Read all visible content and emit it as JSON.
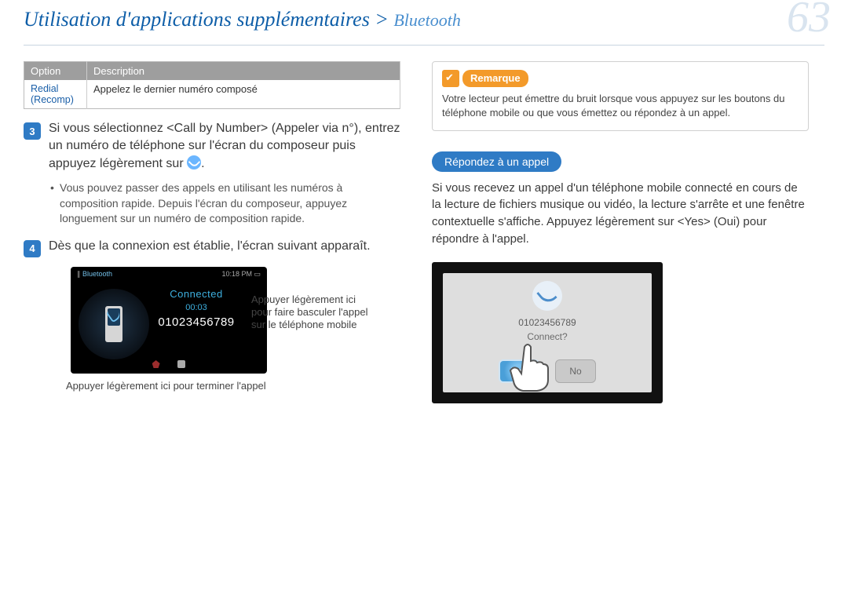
{
  "header": {
    "breadcrumb_main": "Utilisation d'applications supplémentaires",
    "breadcrumb_sep": " > ",
    "breadcrumb_sub": "Bluetooth",
    "page_number": "63"
  },
  "left": {
    "table": {
      "head_option": "Option",
      "head_desc": "Description",
      "row_option": "Redial (Recomp)",
      "row_desc": "Appelez le dernier numéro composé"
    },
    "step3": {
      "n": "3",
      "text_before": "Si vous sélectionnez <Call by Number> (Appeler via n°), entrez un numéro de téléphone sur l'écran du composeur puis appuyez légèrement sur ",
      "text_after": ".",
      "bullet": "Vous pouvez passer des appels en utilisant les numéros à composition rapide. Depuis l'écran du composeur, appuyez longuement sur un numéro de composition rapide."
    },
    "step4": {
      "n": "4",
      "text": "Dès que la connexion est établie, l'écran suivant apparaît."
    },
    "screenshot": {
      "bt_label": "Bluetooth",
      "clock": "10:18 PM",
      "connected": "Connected",
      "duration": "00:03",
      "number": "01023456789"
    },
    "callout": "Appuyer légèrement ici pour faire basculer l'appel sur le téléphone mobile",
    "caption_under": "Appuyer légèrement ici pour terminer l'appel"
  },
  "right": {
    "note": {
      "label": "Remarque",
      "text": "Votre lecteur peut émettre du bruit lorsque vous appuyez sur les boutons du téléphone mobile ou que vous émettez ou répondez à un appel."
    },
    "section_title": "Répondez à un appel",
    "section_body": "Si vous recevez un appel d'un téléphone mobile connecté en cours de la lecture de fichiers musique ou vidéo, la lecture s'arrête et une fenêtre contextuelle s'affiche.  Appuyez légèrement sur <Yes> (Oui) pour répondre à l'appel.",
    "incoming": {
      "number": "01023456789",
      "question": "Connect?",
      "yes": "Yes",
      "no": "No"
    }
  }
}
